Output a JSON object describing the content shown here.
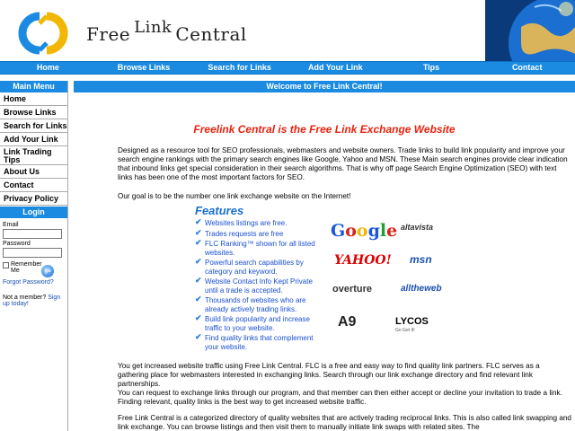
{
  "header": {
    "logo_word_1": "Free",
    "logo_word_2": "Link",
    "logo_word_3": "Central"
  },
  "nav": [
    "Home",
    "Browse Links",
    "Search for Links",
    "Add Your Link",
    "Tips",
    "Contact"
  ],
  "sidebar": {
    "menu_title": "Main Menu",
    "items": [
      "Home",
      "Browse Links",
      "Search for Links",
      "Add Your Link",
      "Link Trading Tips",
      "About Us",
      "Contact",
      "Privacy Policy"
    ],
    "login_title": "Login",
    "email_label": "Email",
    "password_label": "Password",
    "remember_label": "Remember Me",
    "go_label": "go",
    "forgot_link": "Forgot Password?",
    "member_text": "Not a member?",
    "signup_link": "Sign up today!"
  },
  "main": {
    "welcome": "Welcome to Free Link Central!",
    "title": "Freelink Central is the Free Link Exchange Website",
    "para1": "Designed as a resource tool for SEO professionals, webmasters and website owners. Trade links to build link popularity and improve your search engine rankings with the primary search engines like Google, Yahoo and MSN. These Main search engines provide clear indication that inbound links get special consideration in their search algorithms. That is why off page Search Engine Optimization (SEO) with text links has been one of the most important factors for SEO.",
    "para2": "Our goal is to be the number one link exchange website on the Internet!",
    "features_title": "Features",
    "features": [
      "Websites listings are free.",
      "Trades requests are free",
      "FLC Ranking™ shown for all listed websites.",
      "Powerful search capabilities by category and keyword.",
      "Website Contact Info Kept Private until a trade is accepted.",
      "Thousands of websites who are already actively trading links.",
      "Build link popularity and increase traffic to your website.",
      "Find quality links that complement your website."
    ],
    "logos": {
      "google": "Google",
      "altavista": "altavista",
      "yahoo": "YAHOO!",
      "msn": "msn",
      "overture": "overture",
      "alltheweb": "alltheweb",
      "a9": "A9",
      "lycos": "LYCOS",
      "lycos_tag": "Go Get It!"
    },
    "para3a": "You get increased website traffic using Free Link Central. FLC is a free and easy way to find quality link partners. FLC serves as a gathering place for webmasters interested in exchanging links. Search through our link exchange directory and find relevant link partnerships.",
    "para3b": "You can request to exchange links through our program, and that member can then either accept or decline your invitation to trade a link. Finding relevant, quality links is the best way to get increased website traffic.",
    "para4": "Free Link Central is a categorized directory of quality websites that are actively trading reciprocal links. This is also called link swapping and link exchange. You can browse listings and then visit them to manually initiate link swaps with related sites. The"
  },
  "colors": {
    "nav_blue": "#1a8be0",
    "title_red": "#e8230f",
    "feature_blue": "#1a4fd0"
  }
}
